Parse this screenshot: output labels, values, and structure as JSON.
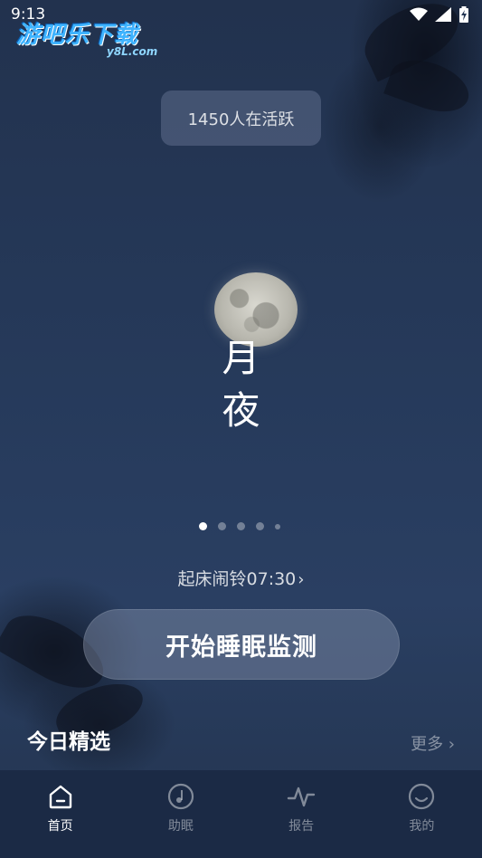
{
  "status_bar": {
    "time": "9:13",
    "icons": [
      "wifi-icon",
      "signal-icon",
      "battery-icon"
    ]
  },
  "watermark": {
    "main": "游吧乐下载",
    "sub": "y8L.com"
  },
  "active_users": "1450人在活跃",
  "scene": {
    "title_line1": "月",
    "title_line2": "夜",
    "pages": 5,
    "current_page": 1
  },
  "alarm": {
    "label": "起床闹铃07:30",
    "icon": "chevron-right-icon"
  },
  "start_button": "开始睡眠监测",
  "today": {
    "title": "今日精选",
    "more": "更多"
  },
  "bottom_nav": [
    {
      "label": "首页",
      "icon": "home-icon",
      "active": true
    },
    {
      "label": "助眠",
      "icon": "music-note-icon",
      "active": false
    },
    {
      "label": "报告",
      "icon": "pulse-icon",
      "active": false
    },
    {
      "label": "我的",
      "icon": "smiley-icon",
      "active": false
    }
  ],
  "colors": {
    "background": "#243553",
    "nav_background": "#1b2a45",
    "watermark_blue": "#3fb4ff"
  }
}
